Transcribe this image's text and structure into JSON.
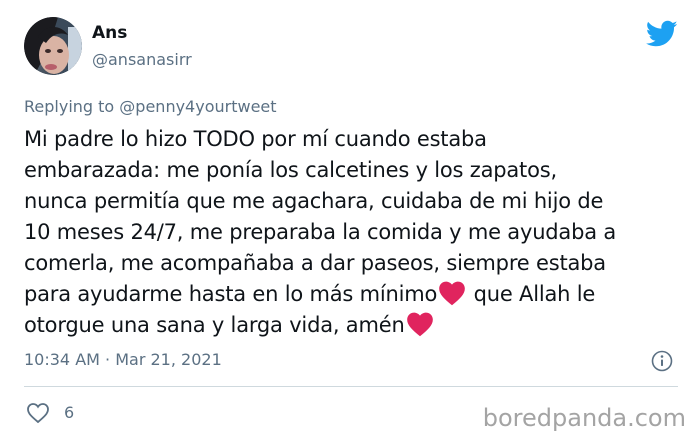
{
  "user": {
    "name": "Ans",
    "handle": "@ansanasirr"
  },
  "reply": {
    "prefix": "Replying to",
    "mention": "@penny4yourtweet"
  },
  "tweet": {
    "lines": [
      "Mi padre lo hizo TODO por mí cuando estaba",
      "embarazada: me ponía los calcetines y los zapatos,",
      "nunca permitía que me agachara, cuidaba de mi hijo de",
      "10 meses 24/7, me preparaba la comida y me ayudaba a",
      "comerla, me acompañaba a dar paseos, siempre estaba"
    ],
    "line6_before": "para ayudarme hasta en lo más mínimo",
    "line6_after": " que Allah le",
    "line7_before": "otorgue una sana y larga vida, amén"
  },
  "meta": {
    "time": "10:34 AM",
    "separator": " · ",
    "date": "Mar 21, 2021"
  },
  "actions": {
    "like_count": "6"
  },
  "watermark": "boredpanda.com",
  "colors": {
    "twitter_blue": "#1da1f2",
    "heart_red": "#e0245e",
    "secondary_text": "#5b7083"
  },
  "icons": [
    "twitter-bird-icon",
    "heart-emoji-icon",
    "info-icon",
    "like-heart-icon"
  ]
}
